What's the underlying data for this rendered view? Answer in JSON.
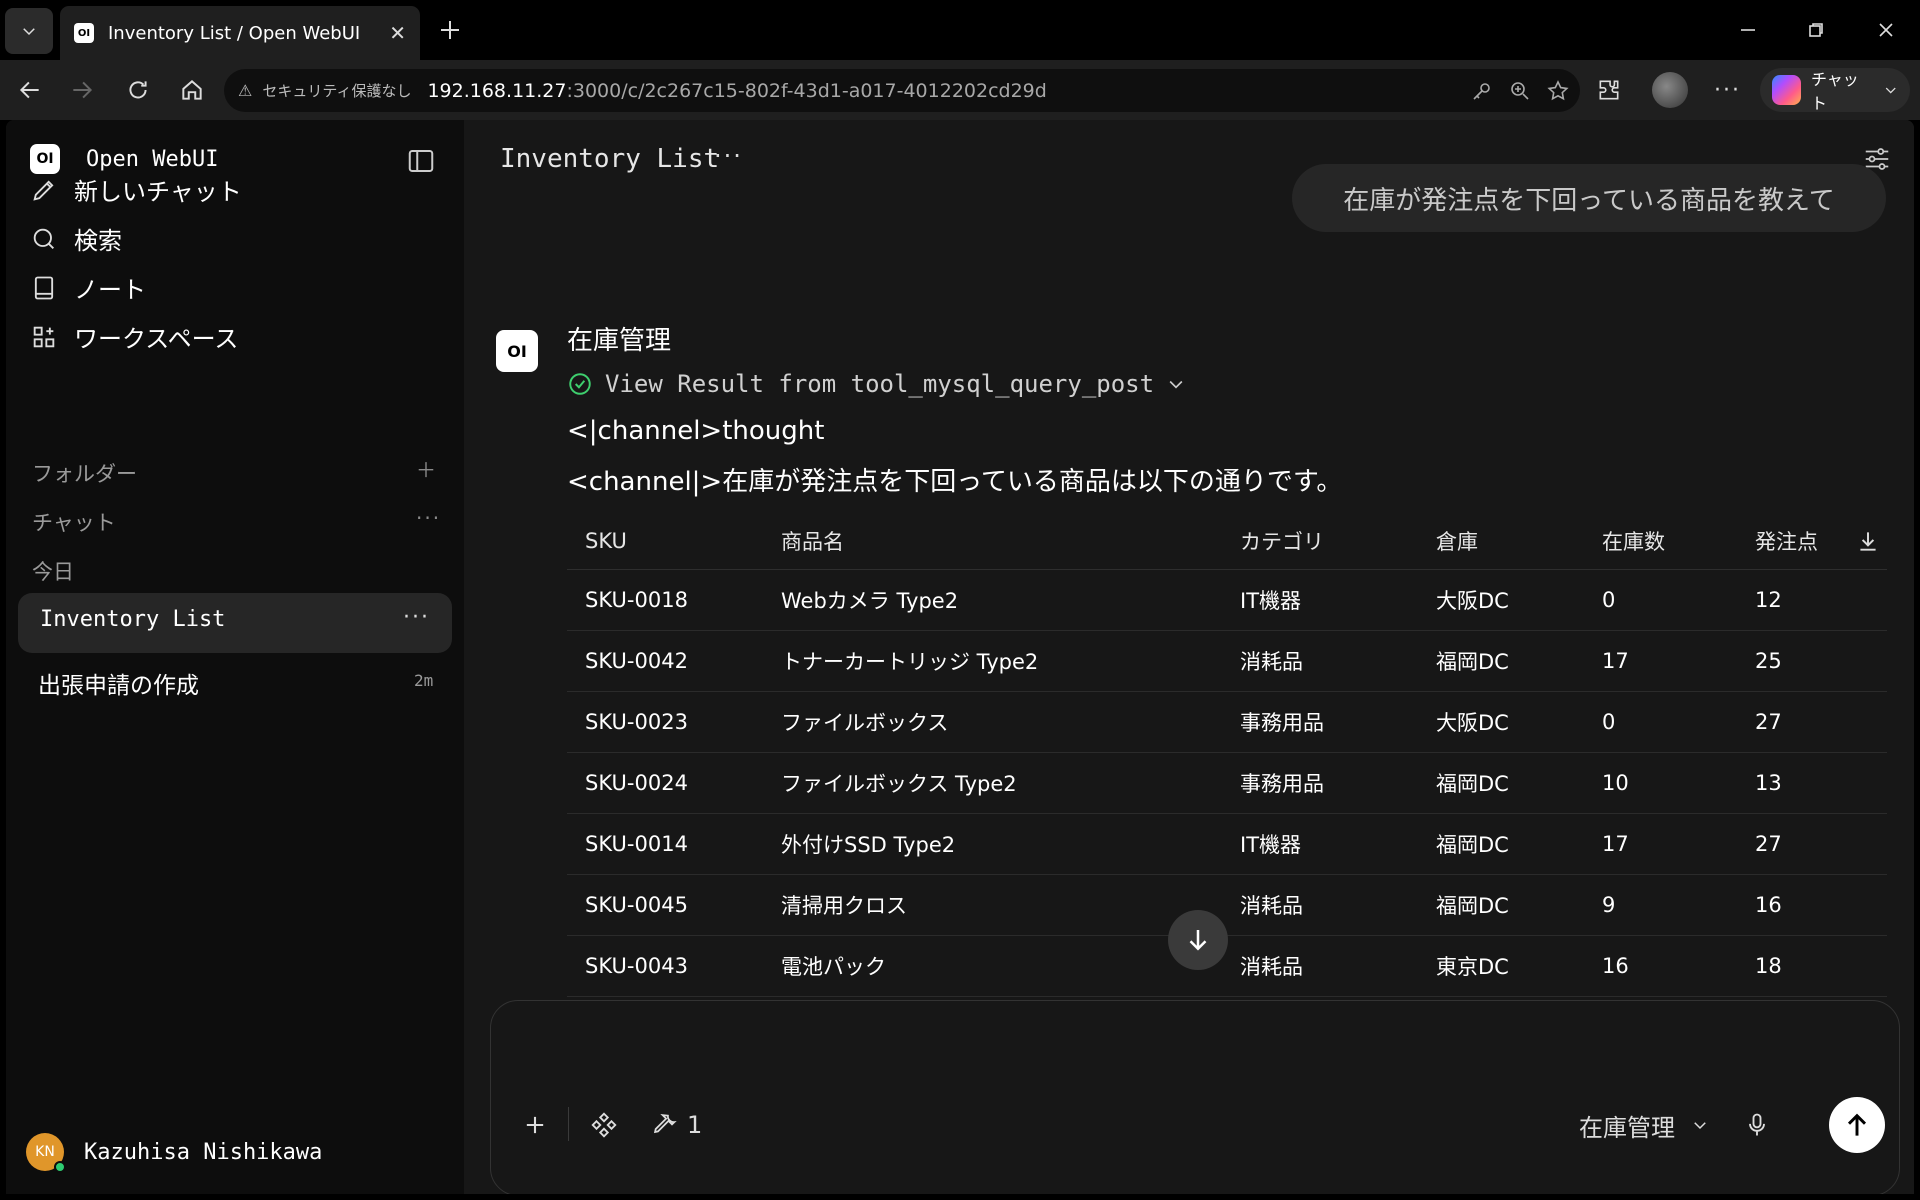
{
  "browser": {
    "tab_title": "Inventory List / Open WebUI",
    "security_label": "セキュリティ保護なし",
    "url_host": "192.168.11.27",
    "url_path": ":3000/c/2c267c15-802f-43d1-a017-4012202cd29d",
    "copilot_label": "チャット"
  },
  "sidebar": {
    "brand": "Open WebUI",
    "nav": [
      {
        "label": "新しいチャット",
        "icon": "pencil-icon"
      },
      {
        "label": "検索",
        "icon": "search-icon"
      },
      {
        "label": "ノート",
        "icon": "notebook-icon"
      },
      {
        "label": "ワークスペース",
        "icon": "grid-icon"
      }
    ],
    "folders_label": "フォルダー",
    "chats_label": "チャット",
    "today_label": "今日",
    "chats": [
      {
        "title": "Inventory List"
      },
      {
        "title": "出張申請の作成",
        "time": "2m"
      }
    ],
    "user": {
      "initials": "KN",
      "name": "Kazuhisa Nishikawa"
    }
  },
  "main": {
    "chat_title": "Inventory List",
    "user_message": "在庫が発注点を下回っている商品を教えて",
    "model_badge": "OI",
    "model_name": "在庫管理",
    "tool_result": "View Result from tool_mysql_query_post",
    "line1": "<|channel>thought",
    "line2": "<channel|>在庫が発注点を下回っている商品は以下の通りです。",
    "table": {
      "headers": [
        "SKU",
        "商品名",
        "カテゴリ",
        "倉庫",
        "在庫数",
        "発注点"
      ],
      "rows": [
        [
          "SKU-0018",
          "Webカメラ Type2",
          "IT機器",
          "大阪DC",
          "0",
          "12"
        ],
        [
          "SKU-0042",
          "トナーカートリッジ Type2",
          "消耗品",
          "福岡DC",
          "17",
          "25"
        ],
        [
          "SKU-0023",
          "ファイルボックス",
          "事務用品",
          "大阪DC",
          "0",
          "27"
        ],
        [
          "SKU-0024",
          "ファイルボックス Type2",
          "事務用品",
          "福岡DC",
          "10",
          "13"
        ],
        [
          "SKU-0014",
          "外付けSSD Type2",
          "IT機器",
          "福岡DC",
          "17",
          "27"
        ],
        [
          "SKU-0045",
          "清掃用クロス",
          "消耗品",
          "福岡DC",
          "9",
          "16"
        ],
        [
          "SKU-0043",
          "電池パック",
          "消耗品",
          "東京DC",
          "16",
          "18"
        ]
      ]
    },
    "composer": {
      "tool_count": "1",
      "model_select": "在庫管理"
    }
  }
}
